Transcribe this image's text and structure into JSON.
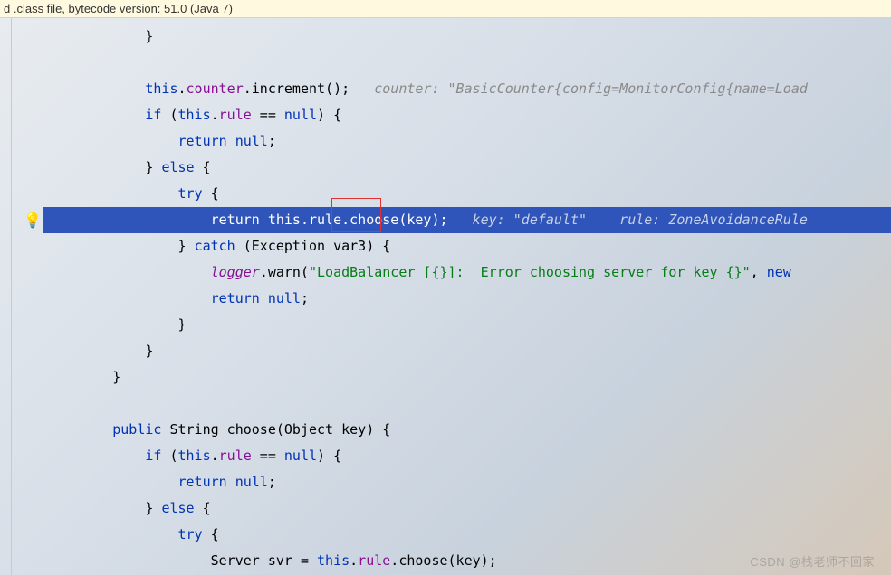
{
  "banner": {
    "text": "d .class file, bytecode version: 51.0 (Java 7)"
  },
  "icons": {
    "bulb": "💡"
  },
  "code": {
    "l1": "            }",
    "l2": "",
    "l3_a": "            ",
    "l3_this": "this",
    "l3_b": ".",
    "l3_counter": "counter",
    "l3_c": ".increment();   ",
    "l3_hint": "counter: \"BasicCounter{config=MonitorConfig{name=Load",
    "l4_a": "            ",
    "l4_if": "if",
    "l4_b": " (",
    "l4_this": "this",
    "l4_c": ".",
    "l4_rule": "rule",
    "l4_d": " == ",
    "l4_null": "null",
    "l4_e": ") {",
    "l5_a": "                ",
    "l5_return": "return",
    "l5_b": " ",
    "l5_null": "null",
    "l5_c": ";",
    "l6_a": "            } ",
    "l6_else": "else",
    "l6_b": " {",
    "l7_a": "                ",
    "l7_try": "try",
    "l7_b": " {",
    "l8_a": "                    ",
    "l8_return": "return",
    "l8_b": " ",
    "l8_this": "this",
    "l8_c": ".rule.choose(key);   ",
    "l8_hint1": "key: \"default\"",
    "l8_hint2": "    rule: ZoneAvoidanceRule",
    "l9_a": "                } ",
    "l9_catch": "catch",
    "l9_b": " (Exception var3) {",
    "l10_a": "                    ",
    "l10_logger": "logger",
    "l10_b": ".warn(",
    "l10_str": "\"LoadBalancer [{}]:  Error choosing server for key {}\"",
    "l10_c": ", ",
    "l10_new": "new",
    "l10_d": " ",
    "l11_a": "                    ",
    "l11_return": "return",
    "l11_b": " ",
    "l11_null": "null",
    "l11_c": ";",
    "l12": "                }",
    "l13": "            }",
    "l14": "        }",
    "l15": "",
    "l16_a": "        ",
    "l16_public": "public",
    "l16_b": " String choose(Object key) {",
    "l17_a": "            ",
    "l17_if": "if",
    "l17_b": " (",
    "l17_this": "this",
    "l17_c": ".",
    "l17_rule": "rule",
    "l17_d": " == ",
    "l17_null": "null",
    "l17_e": ") {",
    "l18_a": "                ",
    "l18_return": "return",
    "l18_b": " ",
    "l18_null": "null",
    "l18_c": ";",
    "l19_a": "            } ",
    "l19_else": "else",
    "l19_b": " {",
    "l20_a": "                ",
    "l20_try": "try",
    "l20_b": " {",
    "l21_a": "                    Server svr = ",
    "l21_this": "this",
    "l21_b": ".",
    "l21_rule": "rule",
    "l21_c": ".choose(key);"
  },
  "watermark": "CSDN @栈老师不回家"
}
